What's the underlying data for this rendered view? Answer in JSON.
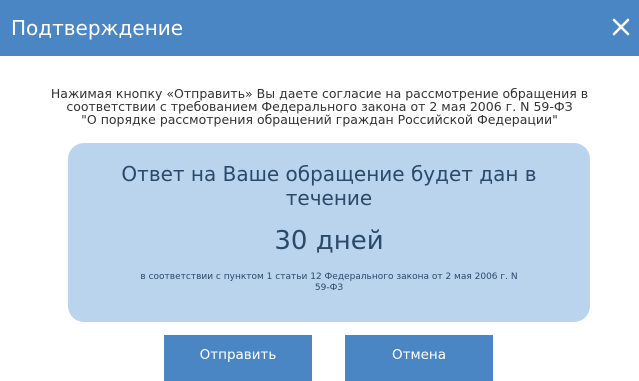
{
  "dialog": {
    "title": "Подтверждение",
    "close_icon": "close-icon"
  },
  "notice": {
    "lines": [
      "Нажимая кнопку «Отправить» Вы даете согласие на рассмотрение обращения в",
      "соответствии с требованием Федерального закона от 2 мая 2006 г. N 59-ФЗ",
      "\"О порядке рассмотрения обращений граждан Российской Федерации\""
    ]
  },
  "info": {
    "headline_lines": [
      "Ответ на Ваше обращение будет дан в",
      "течение"
    ],
    "days": "30 дней",
    "footnote_lines": [
      "в соответствии с пунктом 1 статьи 12 Федерального закона от 2 мая 2006 г. N",
      "59-ФЗ"
    ]
  },
  "buttons": {
    "send_label": "Отправить",
    "cancel_label": "Отмена"
  },
  "colors": {
    "primary": "#4a85c4",
    "info_background": "#b9d4ec",
    "info_text": "#2b4a6a"
  }
}
